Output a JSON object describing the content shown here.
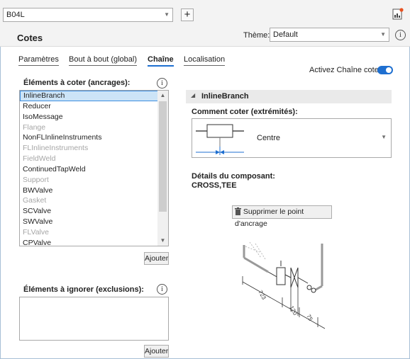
{
  "toolbar": {
    "project": "B04L",
    "add_symbol": "+"
  },
  "header": {
    "title": "Cotes",
    "theme_label": "Thème:",
    "theme_value": "Default",
    "info_symbol": "i"
  },
  "tabs": [
    {
      "label": "Paramètres"
    },
    {
      "label": "Bout à bout (global)"
    },
    {
      "label": "Chaîne"
    },
    {
      "label": "Localisation"
    }
  ],
  "toggle": {
    "label": "Activez Chaîne cotes:",
    "on": true
  },
  "anchors": {
    "label": "Éléments à coter (ancrages):",
    "items": [
      {
        "label": "InlineBranch",
        "state": "selected"
      },
      {
        "label": "Reducer",
        "state": "normal"
      },
      {
        "label": "IsoMessage",
        "state": "normal"
      },
      {
        "label": "Flange",
        "state": "disabled"
      },
      {
        "label": "NonFLInlineInstruments",
        "state": "normal"
      },
      {
        "label": "FLInlineInstruments",
        "state": "disabled"
      },
      {
        "label": "FieldWeld",
        "state": "disabled"
      },
      {
        "label": "ContinuedTapWeld",
        "state": "normal"
      },
      {
        "label": "Support",
        "state": "disabled"
      },
      {
        "label": "BWValve",
        "state": "normal"
      },
      {
        "label": "Gasket",
        "state": "disabled"
      },
      {
        "label": "SCValve",
        "state": "normal"
      },
      {
        "label": "SWValve",
        "state": "normal"
      },
      {
        "label": "FLValve",
        "state": "disabled"
      },
      {
        "label": "CPValve",
        "state": "normal"
      }
    ],
    "add_button": "Ajouter"
  },
  "exclusions": {
    "label": "Éléments à ignorer (exclusions):",
    "add_button": "Ajouter"
  },
  "detail": {
    "section_title": "InlineBranch",
    "how_label": "Comment coter (extrémités):",
    "how_value": "Centre",
    "component_label": "Détails du composant:",
    "component_value": "CROSS,TEE",
    "remove_button": "Supprimer le point d'ancrage",
    "dims": [
      "723",
      "120",
      "75"
    ]
  },
  "colors": {
    "accent": "#1e6fd0",
    "selection": "#cce4f7",
    "disabled_text": "#a6a6a6"
  }
}
